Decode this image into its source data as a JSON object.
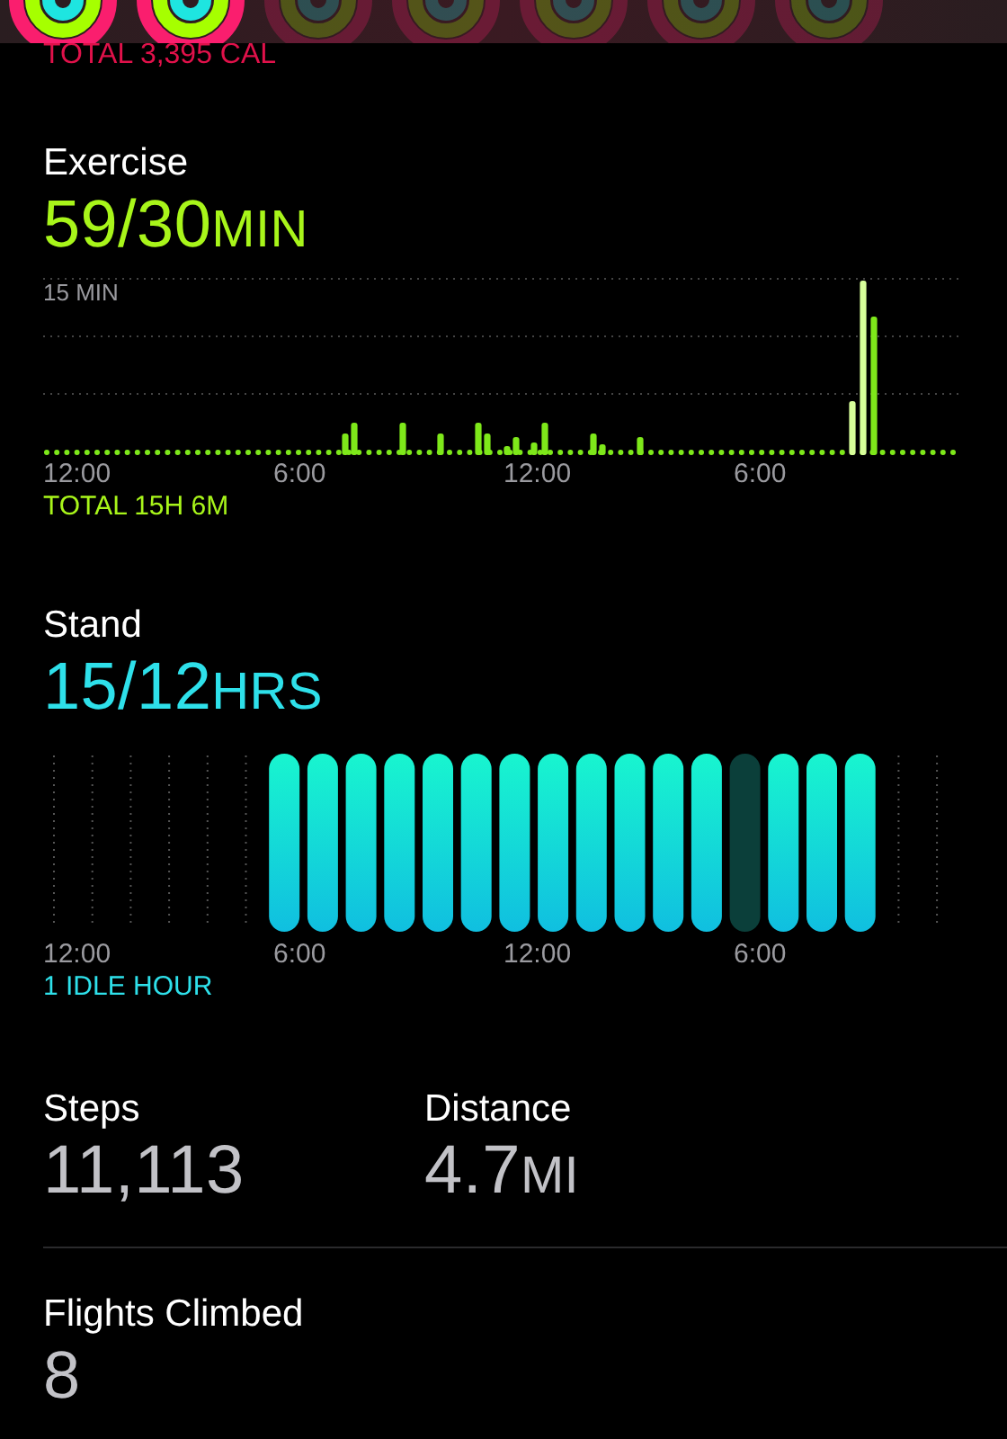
{
  "rings": [
    {
      "dimmed": false
    },
    {
      "dimmed": false
    },
    {
      "dimmed": true
    },
    {
      "dimmed": true
    },
    {
      "dimmed": true
    },
    {
      "dimmed": true
    },
    {
      "dimmed": true
    }
  ],
  "move": {
    "total": "TOTAL 3,395 CAL"
  },
  "exercise": {
    "title": "Exercise",
    "value": "59/30",
    "unit": "MIN",
    "gridline_label": "15 MIN",
    "axis_labels": [
      "12:00",
      "6:00",
      "12:00",
      "6:00"
    ],
    "total": "TOTAL 15H 6M"
  },
  "stand": {
    "title": "Stand",
    "value": "15/12",
    "unit": "HRS",
    "hours": [
      {
        "kind": "empty"
      },
      {
        "kind": "empty"
      },
      {
        "kind": "empty"
      },
      {
        "kind": "empty"
      },
      {
        "kind": "empty"
      },
      {
        "kind": "empty"
      },
      {
        "kind": "stood"
      },
      {
        "kind": "stood"
      },
      {
        "kind": "stood"
      },
      {
        "kind": "stood"
      },
      {
        "kind": "stood"
      },
      {
        "kind": "stood"
      },
      {
        "kind": "stood"
      },
      {
        "kind": "stood"
      },
      {
        "kind": "stood"
      },
      {
        "kind": "stood"
      },
      {
        "kind": "stood"
      },
      {
        "kind": "stood"
      },
      {
        "kind": "idle"
      },
      {
        "kind": "stood"
      },
      {
        "kind": "stood"
      },
      {
        "kind": "stood"
      },
      {
        "kind": "empty"
      },
      {
        "kind": "empty"
      }
    ],
    "axis_labels": [
      "12:00",
      "6:00",
      "12:00",
      "6:00"
    ],
    "idle": "1 IDLE HOUR"
  },
  "steps": {
    "title": "Steps",
    "value": "11,113"
  },
  "distance": {
    "title": "Distance",
    "value": "4.7",
    "unit": "MI"
  },
  "flights": {
    "title": "Flights Climbed",
    "value": "8"
  }
}
